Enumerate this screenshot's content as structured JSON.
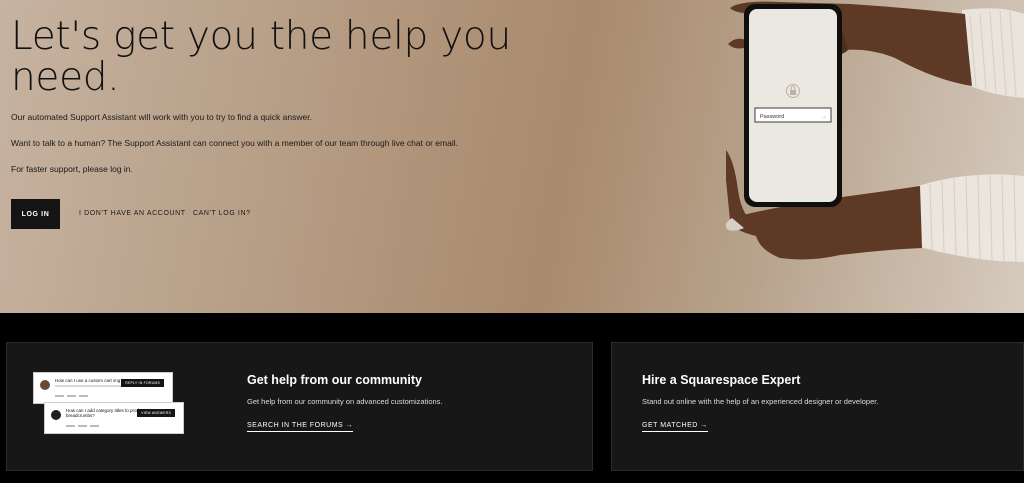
{
  "hero": {
    "title": "Let's get you the help you need.",
    "p1": "Our automated Support Assistant will work with you to try to find a quick answer.",
    "p2": "Want to talk to a human? The Support Assistant can connect you with a member of our team through live chat or email.",
    "p3": "For faster support, please log in.",
    "login_label": "LOG IN",
    "no_account_label": "I DON'T HAVE AN ACCOUNT",
    "cant_login_label": "CAN'T LOG IN?",
    "phone_password_placeholder": "Password"
  },
  "community": {
    "title": "Get help from our community",
    "desc": "Get help from our community on advanced customizations.",
    "link": "SEARCH IN THE FORUMS →",
    "preview_q1": "How can I use a custom cart img icon?",
    "preview_q2": "How can I add category titles to product breadcrumbs?",
    "preview_btn1": "REPLY IN FORUMS",
    "preview_btn2": "VIEW ANSWERS"
  },
  "expert": {
    "title": "Hire a Squarespace Expert",
    "desc": "Stand out online with the help of an experienced designer or developer.",
    "link": "GET MATCHED →"
  },
  "colors": {
    "button_bg": "#141414",
    "card_bg": "#171717",
    "page_bg": "#000000"
  }
}
